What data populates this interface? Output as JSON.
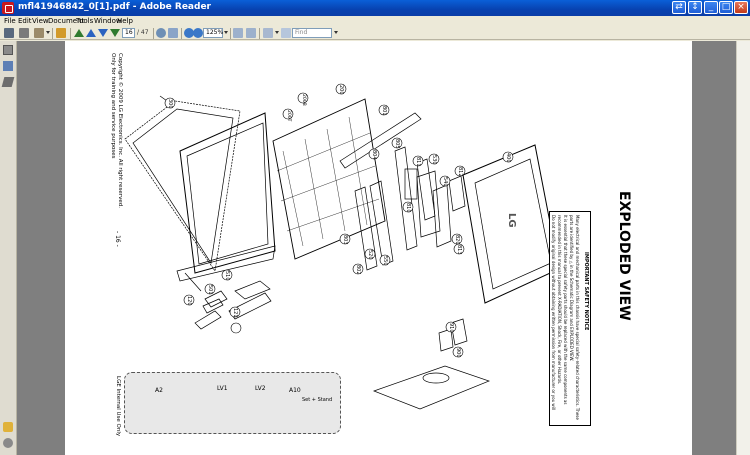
{
  "window": {
    "title": "mfl41946842_0[1].pdf - Adobe Reader",
    "controls": {
      "minimize": "_",
      "maximize": "□",
      "close": "×",
      "extra": "⇄"
    }
  },
  "menu": [
    "File",
    "Edit",
    "View",
    "Document",
    "Tools",
    "Window",
    "Help"
  ],
  "toolbar": {
    "page_number": "16",
    "page_count": "/ 47",
    "zoom": "125%",
    "find_placeholder": "Find"
  },
  "document": {
    "heading": "EXPLODED VIEW",
    "safety_title": "IMPORTANT SAFETY NOTICE",
    "safety_text": [
      "Many electrical and mechanical parts in this chassis have special safety-related characteristics. These",
      "parts are identified by △ in the Schematic Diagram and EXPLODED VIEW.",
      "It is essential that these special safety parts should be replaced with the same components as",
      "recommended in this manual to prevent X-RADIATION, Shock, Fire, or other Hazards.",
      "Do not modify original design without obtaining written permission from manufacturer or you will"
    ],
    "copyright": "Copyright © 2009 LG Electronics. Inc. All right reserved.",
    "training": "Only for training and service purposes",
    "page_label": "- 16 -",
    "internal_use": "LGE Internal Use Only",
    "part_labels": [
      "300",
      "200",
      "200B",
      "200T",
      "801",
      "804",
      "805",
      "803",
      "802",
      "550",
      "520",
      "811",
      "810",
      "540",
      "530",
      "812",
      "820",
      "813",
      "400",
      "510",
      "501",
      "120",
      "121",
      "910",
      "900"
    ],
    "accessories": [
      "A2",
      "LV1",
      "LV2",
      "A10"
    ],
    "set_stand": "Set + Stand",
    "logo": "LG"
  }
}
